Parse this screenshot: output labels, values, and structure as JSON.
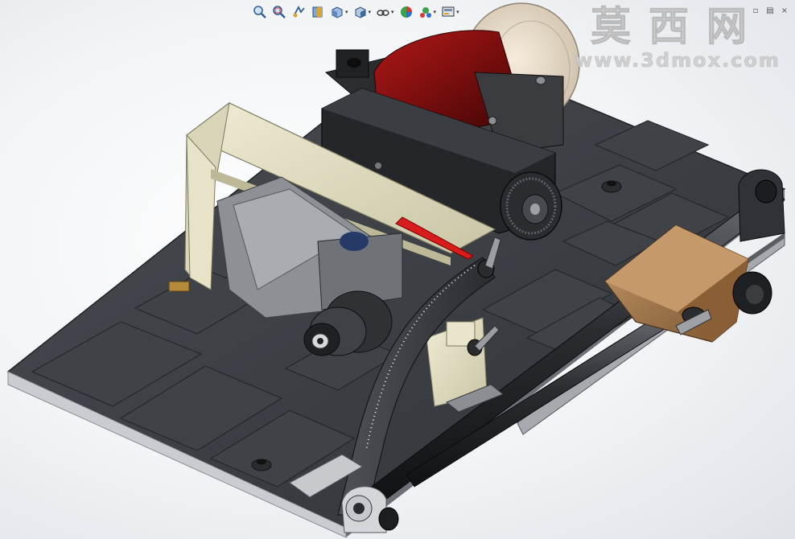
{
  "window": {
    "controls": [
      {
        "name": "restore-button",
        "glyph": "▫"
      },
      {
        "name": "tile-button",
        "glyph": "▤"
      },
      {
        "name": "close-button",
        "glyph": "×"
      }
    ]
  },
  "toolbar": {
    "buttons": [
      {
        "name": "zoom-to-fit-button",
        "icon": "zoom-fit-icon",
        "dropdown": false
      },
      {
        "name": "zoom-to-area-button",
        "icon": "zoom-area-icon",
        "dropdown": false
      },
      {
        "name": "previous-view-button",
        "icon": "previous-view-icon",
        "dropdown": false
      },
      {
        "name": "section-view-button",
        "icon": "section-view-icon",
        "dropdown": false
      },
      {
        "name": "view-orientation-button",
        "icon": "view-orientation-icon",
        "dropdown": true
      },
      {
        "name": "display-style-button",
        "icon": "display-style-icon",
        "dropdown": true
      },
      {
        "name": "hide-show-items-button",
        "icon": "hide-show-icon",
        "dropdown": true
      },
      {
        "name": "edit-appearance-button",
        "icon": "appearance-icon",
        "dropdown": false
      },
      {
        "name": "apply-scene-button",
        "icon": "scene-icon",
        "dropdown": true
      },
      {
        "name": "view-settings-button",
        "icon": "view-settings-icon",
        "dropdown": true
      }
    ]
  },
  "watermark": {
    "chinese": "莫西网",
    "url": "www.3dmox.com"
  },
  "colors": {
    "plate": "#3a3d42",
    "frame": "#e2dfc4",
    "motor": "#7a0e0e",
    "carriage": "#a47a4c",
    "rod": "#2e3034",
    "pointer": "#d81c1c"
  }
}
